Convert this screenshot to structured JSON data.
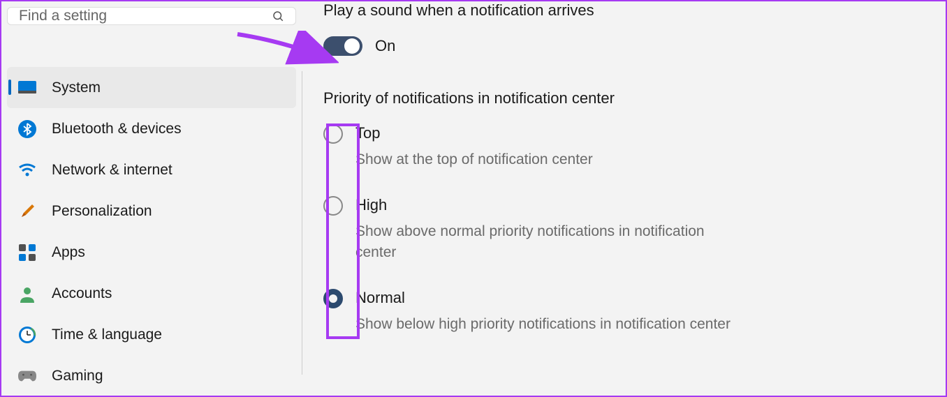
{
  "search": {
    "placeholder": "Find a setting"
  },
  "sidebar": {
    "items": [
      {
        "label": "System",
        "icon": "system",
        "active": true
      },
      {
        "label": "Bluetooth & devices",
        "icon": "bluetooth",
        "active": false
      },
      {
        "label": "Network & internet",
        "icon": "wifi",
        "active": false
      },
      {
        "label": "Personalization",
        "icon": "brush",
        "active": false
      },
      {
        "label": "Apps",
        "icon": "apps",
        "active": false
      },
      {
        "label": "Accounts",
        "icon": "account",
        "active": false
      },
      {
        "label": "Time & language",
        "icon": "clock",
        "active": false
      },
      {
        "label": "Gaming",
        "icon": "gaming",
        "active": false
      }
    ]
  },
  "content": {
    "sound_title": "Play a sound when a notification arrives",
    "toggle_state": "On",
    "priority_title": "Priority of notifications in notification center",
    "options": [
      {
        "title": "Top",
        "desc": "Show at the top of notification center",
        "selected": false
      },
      {
        "title": "High",
        "desc": "Show above normal priority notifications in notification center",
        "selected": false
      },
      {
        "title": "Normal",
        "desc": "Show below high priority notifications in notification center",
        "selected": true
      }
    ]
  },
  "annotation": {
    "arrow_color": "#a63af2",
    "highlight_color": "#a63af2"
  }
}
